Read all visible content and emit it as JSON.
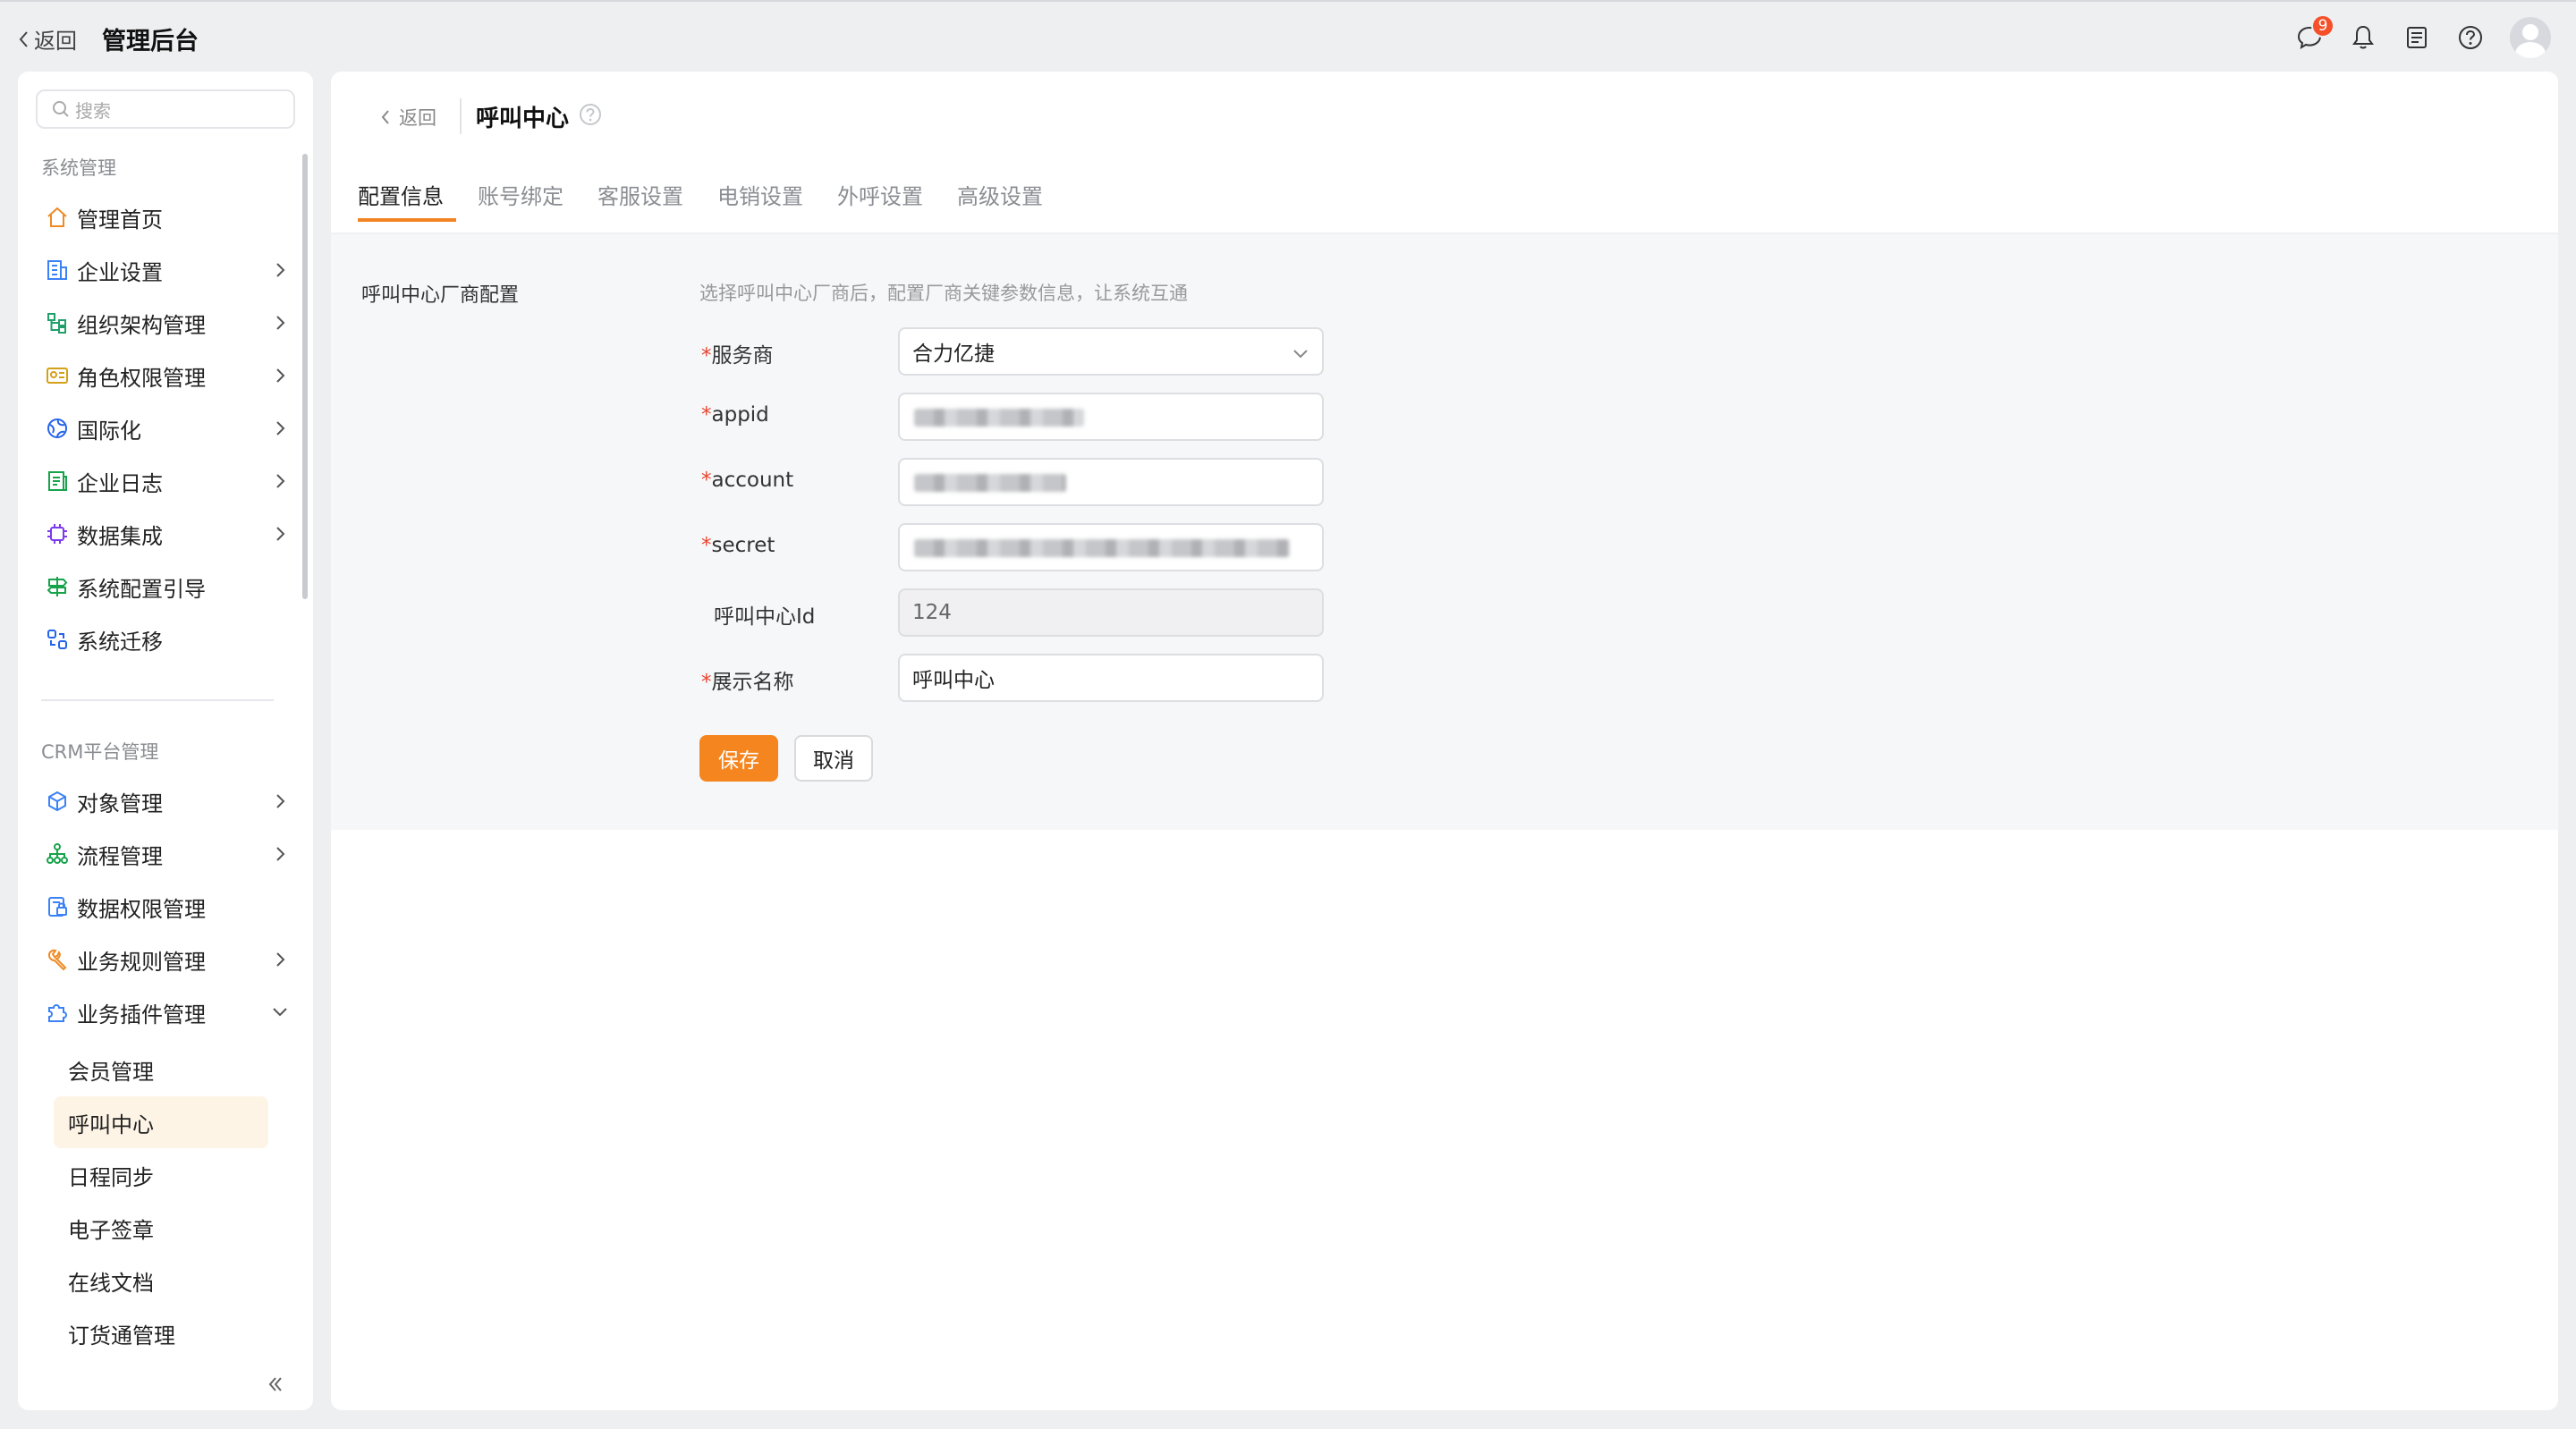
{
  "topbar": {
    "back_label": "返回",
    "title": "管理后台",
    "message_badge": "9",
    "icons": [
      "message-icon",
      "bell-icon",
      "notes-icon",
      "help-icon",
      "avatar"
    ]
  },
  "sidebar": {
    "search_placeholder": "搜索",
    "section1_title": "系统管理",
    "section1_items": [
      {
        "label": "管理首页",
        "icon": "home-icon"
      },
      {
        "label": "企业设置",
        "icon": "building-icon"
      },
      {
        "label": "组织架构管理",
        "icon": "org-tree-icon"
      },
      {
        "label": "角色权限管理",
        "icon": "id-card-icon"
      },
      {
        "label": "国际化",
        "icon": "globe-icon"
      },
      {
        "label": "企业日志",
        "icon": "log-icon"
      },
      {
        "label": "数据集成",
        "icon": "chip-icon"
      },
      {
        "label": "系统配置引导",
        "icon": "signpost-icon"
      },
      {
        "label": "系统迁移",
        "icon": "migrate-icon"
      }
    ],
    "section2_title": "CRM平台管理",
    "section2_items": [
      {
        "label": "对象管理",
        "icon": "cube-icon"
      },
      {
        "label": "流程管理",
        "icon": "flow-icon"
      },
      {
        "label": "数据权限管理",
        "icon": "data-lock-icon"
      },
      {
        "label": "业务规则管理",
        "icon": "wrench-icon"
      },
      {
        "label": "业务插件管理",
        "icon": "puzzle-icon"
      }
    ],
    "plugin_sub_items": [
      "会员管理",
      "呼叫中心",
      "日程同步",
      "电子签章",
      "在线文档",
      "订货通管理"
    ],
    "active_sub_item": "呼叫中心"
  },
  "main": {
    "crumb_back": "返回",
    "page_title": "呼叫中心",
    "tabs": [
      "配置信息",
      "账号绑定",
      "客服设置",
      "电销设置",
      "外呼设置",
      "高级设置"
    ],
    "active_tab": "配置信息",
    "section_label": "呼叫中心厂商配置",
    "hint": "选择呼叫中心厂商后，配置厂商关键参数信息，让系统互通",
    "fields": {
      "provider": {
        "label": "服务商",
        "value": "合力亿捷",
        "required": "*"
      },
      "appid": {
        "label": "appid",
        "required": "*"
      },
      "account": {
        "label": "account",
        "required": "*"
      },
      "secret": {
        "label": "secret",
        "required": "*"
      },
      "call_center_id": {
        "label": "呼叫中心Id",
        "value": "124"
      },
      "display_name": {
        "label": "展示名称",
        "value": "呼叫中心",
        "required": "*"
      }
    },
    "save_label": "保存",
    "cancel_label": "取消"
  },
  "colors": {
    "accent": "#f5861f",
    "required": "#e8442e",
    "badge": "#f5502a"
  }
}
